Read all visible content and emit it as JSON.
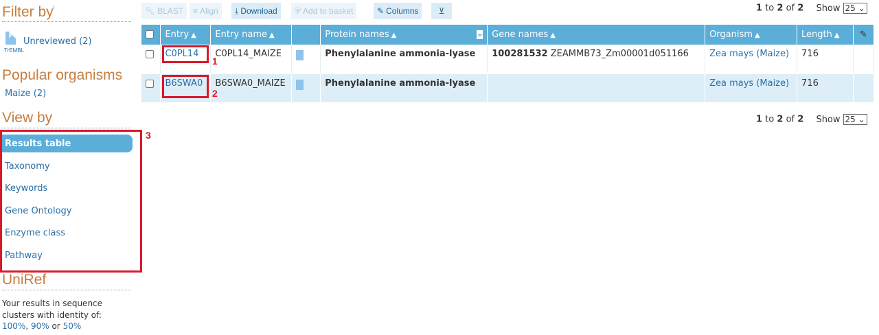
{
  "sidebar": {
    "filter_title": "Filter by",
    "filter_sup": "i",
    "filter_item": {
      "label": "Unreviewed (2)",
      "sub": "TrEMBL"
    },
    "popular_title": "Popular organisms",
    "popular_item": "Maize (2)",
    "view_title": "View by",
    "view_items": [
      {
        "label": "Results table",
        "active": true
      },
      {
        "label": "Taxonomy"
      },
      {
        "label": "Keywords"
      },
      {
        "label": "Gene Ontology"
      },
      {
        "label": "Enzyme class"
      },
      {
        "label": "Pathway"
      }
    ],
    "uniref_title": "UniRef",
    "uniref_text": "Your results in sequence clusters with identity of:",
    "uniref_links": [
      "100%",
      "90%",
      "50%"
    ],
    "uniref_or": "or"
  },
  "toolbar": {
    "blast": "BLAST",
    "align": "Align",
    "download": "Download",
    "basket": "Add to basket",
    "columns": "Columns"
  },
  "pager": {
    "from": "1",
    "to_word": "to",
    "to": "2",
    "of_word": "of",
    "total": "2",
    "show_label": "Show",
    "show_value": "25"
  },
  "table": {
    "headers": [
      "Entry",
      "Entry name",
      "Protein names",
      "Gene names",
      "Organism",
      "Length"
    ],
    "rows": [
      {
        "entry": "C0PL14",
        "entry_name": "C0PL14_MAIZE",
        "protein": "Phenylalanine ammonia-lyase",
        "gene_bold": "100281532",
        "gene_rest": "ZEAMMB73_Zm00001d051166",
        "organism": "Zea mays (Maize)",
        "length": "716"
      },
      {
        "entry": "B6SWA0",
        "entry_name": "B6SWA0_MAIZE",
        "protein": "Phenylalanine ammonia-lyase",
        "gene_bold": "",
        "gene_rest": "",
        "organism": "Zea mays (Maize)",
        "length": "716"
      }
    ]
  },
  "annotations": [
    "1",
    "2",
    "3"
  ],
  "colors": {
    "header_bg": "#5baed8",
    "title": "#c67e3e",
    "link": "#2a6fa6",
    "annotation": "#d9182a",
    "row_alt": "#ddeef8"
  }
}
